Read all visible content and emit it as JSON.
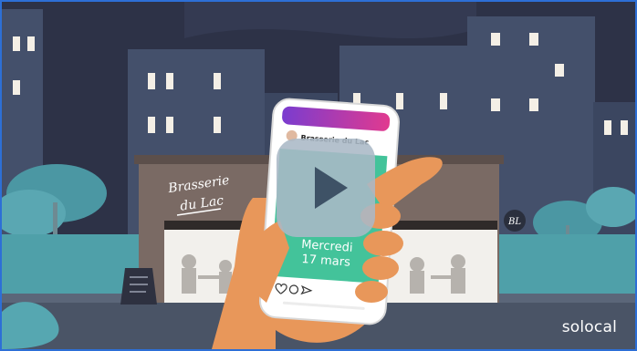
{
  "video": {
    "brand_logo": "solocal",
    "play_icon": "play-icon",
    "scene": {
      "storefront_sign_line1": "Brasserie",
      "storefront_sign_line2": "du Lac",
      "round_badge": "BL",
      "menu_board_icon": "menu-board-icon"
    },
    "phone": {
      "account_name": "Brasserie du Lac",
      "post_day": "Mercredi",
      "post_date": "17 mars",
      "action_icons": [
        "heart-icon",
        "comment-icon",
        "send-icon"
      ]
    }
  },
  "colors": {
    "sky": "#2d3247",
    "buildings": "#44506b",
    "windows": "#f4efe6",
    "trees": "#4b97a3",
    "facade": "#7a6a64",
    "post_green": "#43c39a",
    "gradient_start": "#7a3ccf",
    "gradient_end": "#e13a8f",
    "hand": "#e8975a",
    "play_button": "#aab8c6",
    "frame_border": "#2d6fd6"
  }
}
